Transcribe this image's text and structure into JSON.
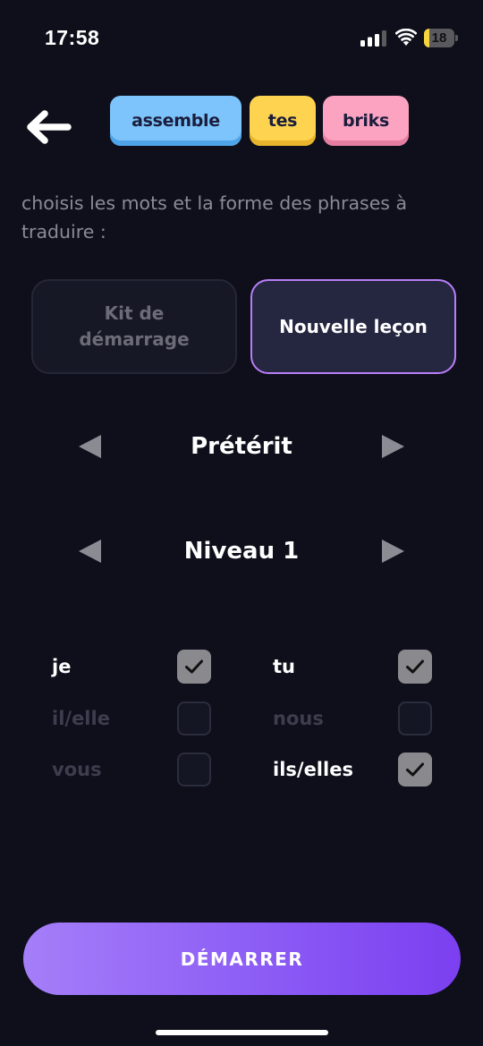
{
  "status_bar": {
    "time": "17:58",
    "battery_level": "18",
    "battery_fraction": 0.18
  },
  "header": {
    "back_icon": "arrow-left-icon",
    "bricks": [
      {
        "label": "assemble",
        "color": "#7cc4fb"
      },
      {
        "label": "tes",
        "color": "#fdd34f"
      },
      {
        "label": "briks",
        "color": "#fba3c0"
      }
    ]
  },
  "instructions": "choisis les mots et la forme des phrases à traduire :",
  "modes": {
    "starter_label": "Kit de démarrage",
    "new_lesson_label": "Nouvelle leçon",
    "selected": "new_lesson"
  },
  "tense_selector": {
    "value": "Prétérit"
  },
  "level_selector": {
    "value": "Niveau 1"
  },
  "pronouns": [
    {
      "label": "je",
      "checked": true
    },
    {
      "label": "tu",
      "checked": true
    },
    {
      "label": "il/elle",
      "checked": false
    },
    {
      "label": "nous",
      "checked": false
    },
    {
      "label": "vous",
      "checked": false
    },
    {
      "label": "ils/elles",
      "checked": true
    }
  ],
  "start_button": {
    "label": "DÉMARRER"
  },
  "colors": {
    "background": "#0e0f1b",
    "accent": "#b87ef7",
    "start_gradient_start": "#a57ef9",
    "start_gradient_end": "#7b3ff0"
  }
}
